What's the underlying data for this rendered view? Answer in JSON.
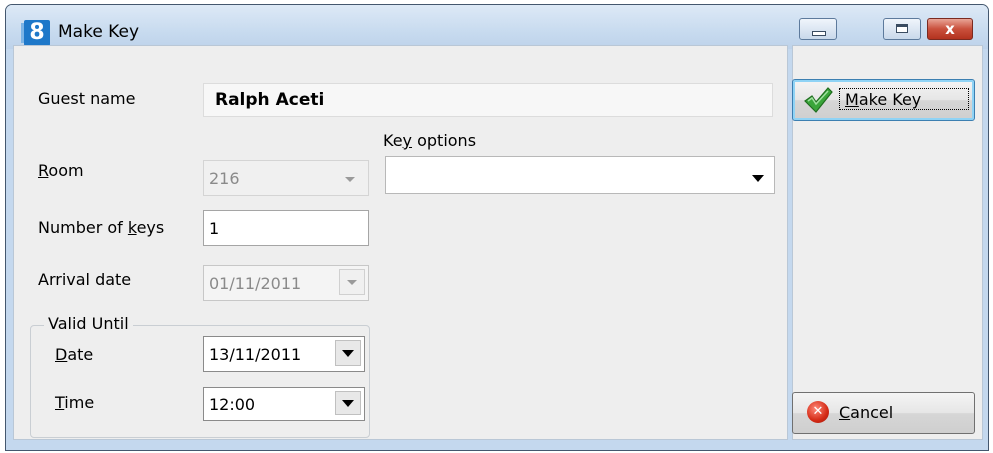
{
  "window": {
    "title": "Make Key",
    "app_icon_text": "8"
  },
  "title_buttons": {
    "minimize": "minimize-icon",
    "maximize": "maximize-icon",
    "close": "close-icon",
    "close_glyph": "x"
  },
  "form": {
    "guest_name_label": "Guest name",
    "guest_name_value": "Ralph Aceti",
    "room_label_u": "R",
    "room_label_rest": "oom",
    "room_value": "216",
    "key_options_label_a": "Ke",
    "key_options_label_u": "y",
    "key_options_label_b": " options",
    "key_options_value": "",
    "num_keys_label_a": "Number of ",
    "num_keys_label_u": "k",
    "num_keys_label_b": "eys",
    "num_keys_value": "1",
    "arrival_label": "Arrival date",
    "arrival_value": "01/11/2011",
    "valid_until": {
      "title": "Valid Until",
      "date_label_u": "D",
      "date_label_rest": "ate",
      "date_value": "13/11/2011",
      "time_label_u": "T",
      "time_label_rest": "ime",
      "time_value": "12:00"
    }
  },
  "buttons": {
    "make_key_u": "M",
    "make_key_rest": "ake Key",
    "cancel_u": "C",
    "cancel_rest": "ancel",
    "cancel_glyph": "✕"
  }
}
